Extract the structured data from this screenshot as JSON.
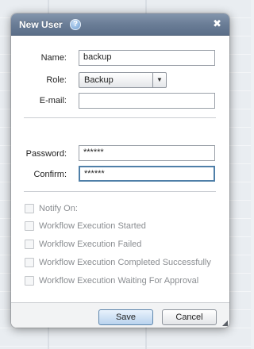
{
  "dialog": {
    "title": "New User",
    "help_icon": "help-icon",
    "close_glyph": "✖",
    "help_glyph": "?"
  },
  "form": {
    "name_label": "Name:",
    "name_value": "backup",
    "role_label": "Role:",
    "role_value": "Backup",
    "email_label": "E-mail:",
    "email_value": "",
    "password_label": "Password:",
    "password_value": "******",
    "confirm_label": "Confirm:",
    "confirm_value": "******"
  },
  "notifications": {
    "notify_on": "Notify On:",
    "options": [
      "Workflow Execution Started",
      "Workflow Execution Failed",
      "Workflow Execution Completed Successfully",
      "Workflow Execution Waiting For Approval"
    ]
  },
  "footer": {
    "save_label": "Save",
    "cancel_label": "Cancel"
  },
  "colors": {
    "titlebar": "#6a7d96",
    "focus_border": "#4f7fa8",
    "disabled_text": "#8a8d91"
  }
}
